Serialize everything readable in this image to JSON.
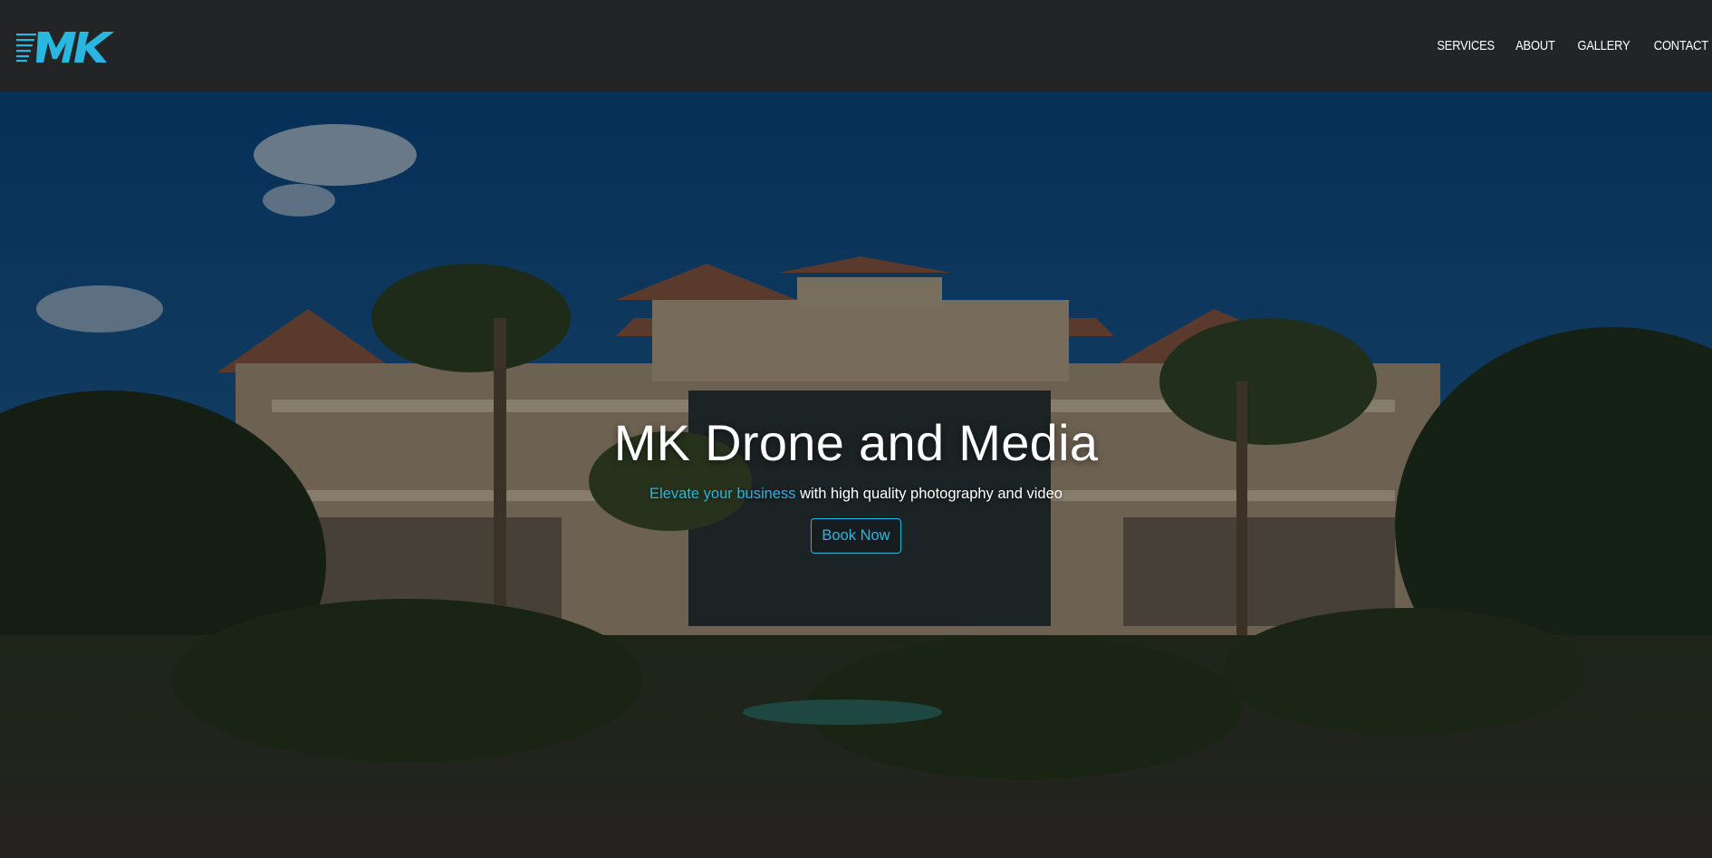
{
  "header": {
    "logo_text": "MK",
    "nav": [
      "SERVICES",
      "ABOUT",
      "GALLERY",
      "CONTACT"
    ]
  },
  "hero": {
    "title": "MK Drone and Media",
    "tagline_accent": "Elevate your business",
    "tagline_rest": " with high quality photography and video",
    "cta": "Book Now"
  },
  "colors": {
    "accent": "#29b6e0",
    "header_bg": "#232426"
  }
}
